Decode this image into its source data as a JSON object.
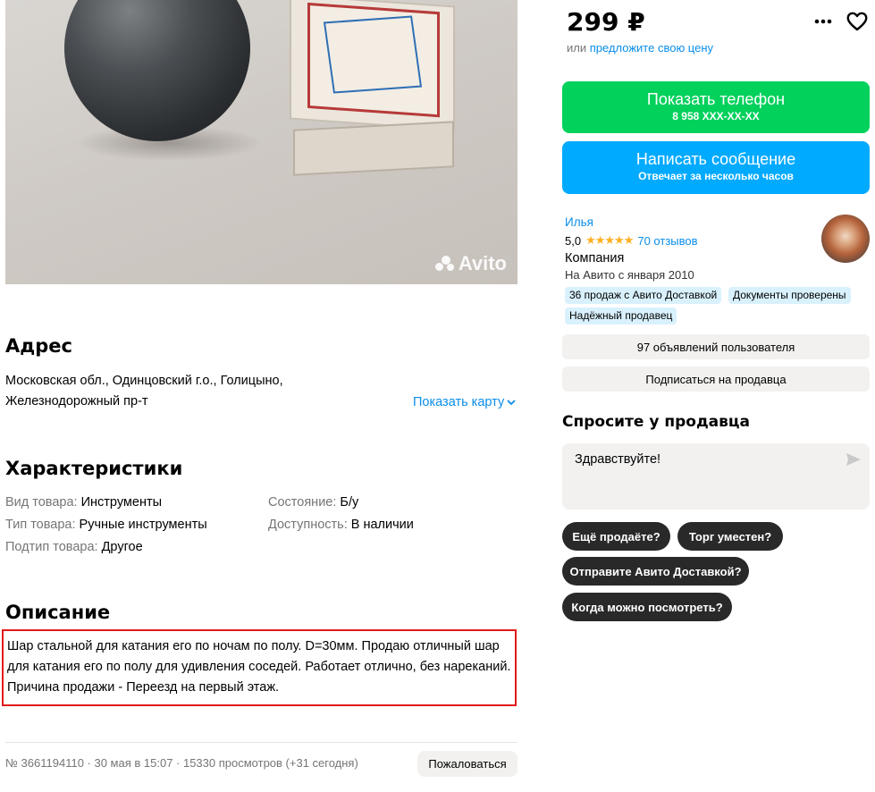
{
  "photo": {
    "watermark": "Avito"
  },
  "address": {
    "title": "Адрес",
    "line1": "Московская обл., Одинцовский г.о., Голицыно,",
    "line2": "Железнодорожный пр-т",
    "show_map": "Показать карту"
  },
  "characteristics": {
    "title": "Характеристики",
    "left": [
      {
        "key": "Вид товара:",
        "value": "Инструменты"
      },
      {
        "key": "Тип товара:",
        "value": "Ручные инструменты"
      },
      {
        "key": "Подтип товара:",
        "value": "Другое"
      }
    ],
    "right": [
      {
        "key": "Состояние:",
        "value": "Б/у"
      },
      {
        "key": "Доступность:",
        "value": "В наличии"
      }
    ]
  },
  "description": {
    "title": "Описание",
    "text": "Шар стальной для катания его по ночам по полу. D=30мм. Продаю отличный шар для катания его по полу для удивления соседей. Работает отлично, без нареканий. Причина продажи - Переезд на первый этаж."
  },
  "footer": {
    "meta": "№ 3661194110 · 30 мая в 15:07 · 15330 просмотров (+31 сегодня)",
    "complain": "Пожаловаться"
  },
  "price": {
    "value": "299 ₽",
    "suggest_prefix": "или",
    "suggest_link": "предложите свою цену"
  },
  "buttons": {
    "phone_main": "Показать телефон",
    "phone_sub": "8 958 XXX-XX-XX",
    "msg_main": "Написать сообщение",
    "msg_sub": "Отвечает за несколько часов"
  },
  "seller": {
    "name": "Илья",
    "rating": "5,0",
    "stars": "★★★★★",
    "reviews": "70 отзывов",
    "type": "Компания",
    "since": "На Авито с января 2010",
    "badges": [
      "36 продаж с Авито Доставкой",
      "Документы проверены",
      "Надёжный продавец"
    ],
    "listings": "97 объявлений пользователя",
    "subscribe": "Подписаться на продавца"
  },
  "ask": {
    "title": "Спросите у продавца",
    "input_value": "Здравствуйте!",
    "chips": [
      "Ещё продаёте?",
      "Торг уместен?",
      "Отправите Авито Доставкой?",
      "Когда можно посмотреть?"
    ]
  },
  "colors": {
    "green": "#02d15c",
    "blue": "#00aaff",
    "link": "#0a8eea",
    "highlight_border": "#e21a1a"
  }
}
